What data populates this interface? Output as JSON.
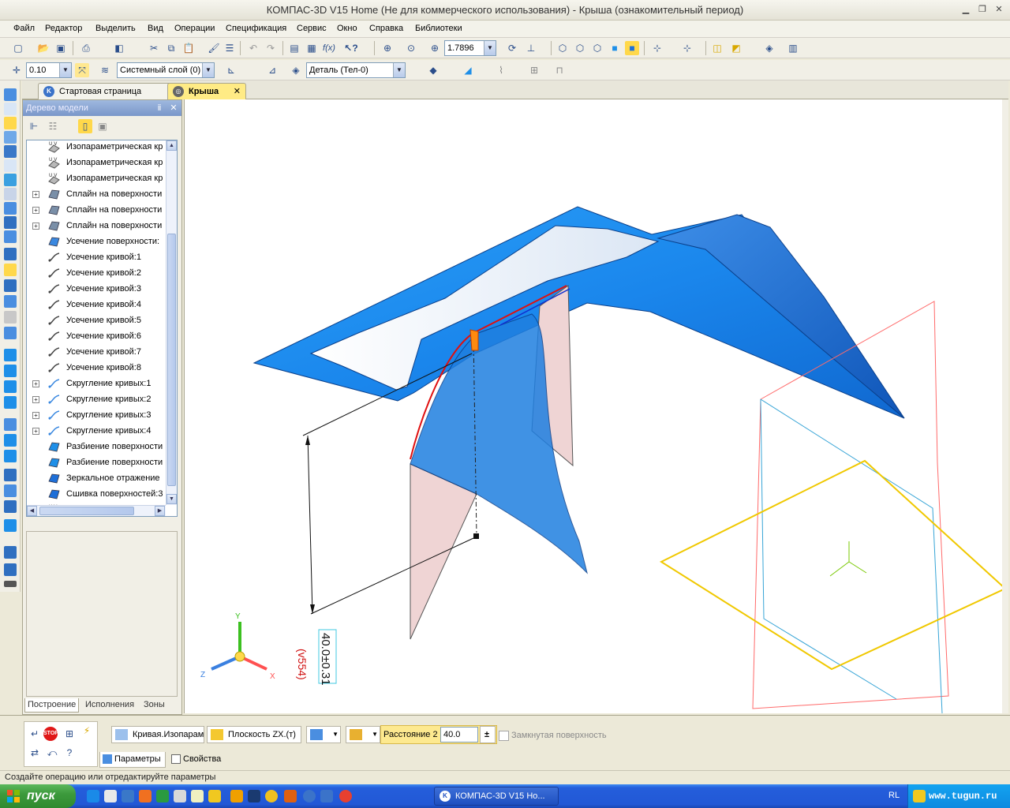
{
  "window": {
    "title": "КОМПАС-3D V15 Home (Не для коммерческого использования) - Крыша (ознакомительный период)"
  },
  "menu": [
    "Файл",
    "Редактор",
    "Выделить",
    "Вид",
    "Операции",
    "Спецификация",
    "Сервис",
    "Окно",
    "Справка",
    "Библиотеки"
  ],
  "toolbar1": {
    "zoom_value": "1.7896"
  },
  "toolbar2": {
    "step_value": "0.10",
    "layer_value": "Системный слой (0)",
    "part_value": "Деталь (Тел-0)"
  },
  "tabs": [
    {
      "label": "Стартовая страница",
      "active": false
    },
    {
      "label": "Крыша",
      "active": true,
      "close": "✕"
    }
  ],
  "model_tree": {
    "title": "Дерево модели",
    "pin": "ⅱ",
    "close": "✕",
    "items": [
      {
        "label": "Изопараметрическая кр",
        "icon": "uv-surface-icon",
        "expandable": false
      },
      {
        "label": "Изопараметрическая кр",
        "icon": "uv-surface-icon",
        "expandable": false
      },
      {
        "label": "Изопараметрическая кр",
        "icon": "uv-surface-icon",
        "expandable": false
      },
      {
        "label": "Сплайн на поверхности",
        "icon": "spline-surface-icon",
        "expandable": true
      },
      {
        "label": "Сплайн на поверхности",
        "icon": "spline-surface-icon",
        "expandable": true
      },
      {
        "label": "Сплайн на поверхности",
        "icon": "spline-surface-icon",
        "expandable": true
      },
      {
        "label": "Усечение поверхности:",
        "icon": "trim-surface-icon",
        "expandable": false
      },
      {
        "label": "Усечение кривой:1",
        "icon": "trim-curve-icon",
        "expandable": false
      },
      {
        "label": "Усечение кривой:2",
        "icon": "trim-curve-icon",
        "expandable": false
      },
      {
        "label": "Усечение кривой:3",
        "icon": "trim-curve-icon",
        "expandable": false
      },
      {
        "label": "Усечение кривой:4",
        "icon": "trim-curve-icon",
        "expandable": false
      },
      {
        "label": "Усечение кривой:5",
        "icon": "trim-curve-icon",
        "expandable": false
      },
      {
        "label": "Усечение кривой:6",
        "icon": "trim-curve-icon",
        "expandable": false
      },
      {
        "label": "Усечение кривой:7",
        "icon": "trim-curve-icon",
        "expandable": false
      },
      {
        "label": "Усечение кривой:8",
        "icon": "trim-curve-icon",
        "expandable": false
      },
      {
        "label": "Скругление кривых:1",
        "icon": "fillet-curve-icon",
        "expandable": true
      },
      {
        "label": "Скругление кривых:2",
        "icon": "fillet-curve-icon",
        "expandable": true
      },
      {
        "label": "Скругление кривых:3",
        "icon": "fillet-curve-icon",
        "expandable": true
      },
      {
        "label": "Скругление кривых:4",
        "icon": "fillet-curve-icon",
        "expandable": true
      },
      {
        "label": "Разбиение поверхности",
        "icon": "split-surface-icon",
        "expandable": false
      },
      {
        "label": "Разбиение поверхности",
        "icon": "split-surface-icon",
        "expandable": false
      },
      {
        "label": "Зеркальное отражение",
        "icon": "mirror-icon",
        "expandable": false
      },
      {
        "label": "Сшивка поверхностей:3",
        "icon": "stitch-surface-icon",
        "expandable": false
      },
      {
        "label": "Изопараметрическая кр",
        "icon": "uv-surface-icon",
        "expandable": false
      }
    ],
    "bottom_tabs": [
      "Построение",
      "Исполнения",
      "Зоны"
    ]
  },
  "viewport": {
    "dimension_text": "40.0±0.31",
    "dimension_note": "(v554)",
    "axis_labels": {
      "x": "X",
      "y": "Y",
      "z": "Z"
    }
  },
  "property_bar": {
    "curve_button": "Кривая.Изопарам",
    "plane_button": "Плоскость ZX.(т)",
    "distance_label": "Расстояние 2",
    "distance_value": "40.0",
    "plusminus": "±",
    "closed_surface": "Замкнутая поверхность",
    "tab_params": "Параметры",
    "tab_props": "Свойства"
  },
  "status_text": "Создайте операцию или отредактируйте параметры",
  "taskbar": {
    "start": "пуск",
    "task": "КОМПАС-3D V15 Но...",
    "lang": "RL",
    "site": "www.tugun.ru"
  }
}
